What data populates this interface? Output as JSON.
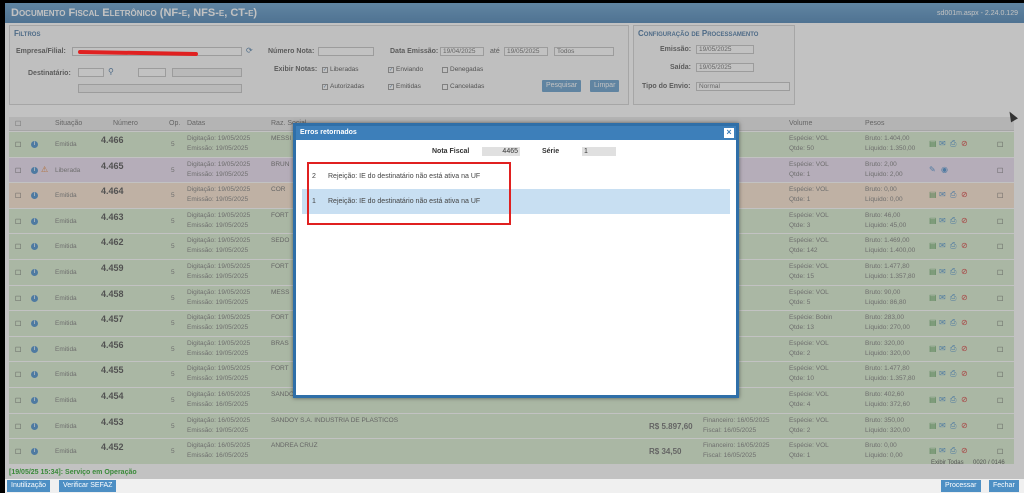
{
  "header": {
    "title": "Documento Fiscal Eletrônico (NF-e, NFS-e, CT-e)",
    "version": "sd001m.aspx - 2.24.0.129"
  },
  "filters": {
    "section": "Filtros",
    "empresa_label": "Empresa/Filial:",
    "destinatario_label": "Destinatário:",
    "numero_label": "Número Nota:",
    "exibir_label": "Exibir Notas:",
    "emissao_label": "Data Emissão:",
    "emissao_de": "19/04/2025",
    "ate_label": "até",
    "emissao_ate": "19/05/2025",
    "periodo": "Todos",
    "checks": [
      "Liberadas",
      "Enviando",
      "Denegadas",
      "Autorizadas",
      "Emitidas",
      "Canceladas"
    ],
    "pesquisar": "Pesquisar",
    "limpar": "Limpar"
  },
  "config": {
    "section": "Configuração de Processamento",
    "emissao_label": "Emissão:",
    "emissao_val": "19/05/2025",
    "saida_label": "Saída:",
    "saida_val": "19/05/2025",
    "tipo_label": "Tipo do Envio:",
    "tipo_val": "Normal"
  },
  "grid": {
    "headers": [
      "Situação",
      "Número",
      "Op.",
      "Datas",
      "Raz. Social",
      "Volume",
      "Pesos"
    ],
    "rows": [
      {
        "sit": "Emitida",
        "num": "4.466",
        "d1": "Digitação: 19/05/2025",
        "d2": "Emissão: 19/05/2025",
        "razao": "MESSI",
        "vol1": "Espécie: VOL",
        "vol2": "Qtde: 50",
        "p1": "Bruto: 1.404,00",
        "p2": "Líquido: 1.350,00",
        "color": "green"
      },
      {
        "sit": "Liberada",
        "num": "4.465",
        "d1": "Digitação: 19/05/2025",
        "d2": "Emissão: 19/05/2025",
        "razao": "BRUN",
        "vol1": "Espécie: VOL",
        "vol2": "Qtde: 1",
        "p1": "Bruto: 2,00",
        "p2": "Líquido: 2,00",
        "color": "purple"
      },
      {
        "sit": "Emitida",
        "num": "4.464",
        "d1": "Digitação: 19/05/2025",
        "d2": "Emissão: 19/05/2025",
        "razao": "COR",
        "vol1": "Espécie: VOL",
        "vol2": "Qtde: 1",
        "p1": "Bruto: 0,00",
        "p2": "Líquido: 0,00",
        "color": "orange"
      },
      {
        "sit": "Emitida",
        "num": "4.463",
        "d1": "Digitação: 19/05/2025",
        "d2": "Emissão: 19/05/2025",
        "razao": "FORT",
        "vol1": "Espécie: VOL",
        "vol2": "Qtde: 3",
        "p1": "Bruto: 46,00",
        "p2": "Líquido: 45,00",
        "color": "green"
      },
      {
        "sit": "Emitida",
        "num": "4.462",
        "d1": "Digitação: 19/05/2025",
        "d2": "Emissão: 19/05/2025",
        "razao": "SEDO",
        "vol1": "Espécie: VOL",
        "vol2": "Qtde: 142",
        "p1": "Bruto: 1.469,00",
        "p2": "Líquido: 1.400,00",
        "color": "green"
      },
      {
        "sit": "Emitida",
        "num": "4.459",
        "d1": "Digitação: 19/05/2025",
        "d2": "Emissão: 19/05/2025",
        "razao": "FORT",
        "vol1": "Espécie: VOL",
        "vol2": "Qtde: 15",
        "p1": "Bruto: 1.477,80",
        "p2": "Líquido: 1.357,80",
        "color": "green"
      },
      {
        "sit": "Emitida",
        "num": "4.458",
        "d1": "Digitação: 19/05/2025",
        "d2": "Emissão: 19/05/2025",
        "razao": "MESS",
        "vol1": "Espécie: VOL",
        "vol2": "Qtde: 5",
        "p1": "Bruto: 90,00",
        "p2": "Líquido: 86,80",
        "color": "green"
      },
      {
        "sit": "Emitida",
        "num": "4.457",
        "d1": "Digitação: 19/05/2025",
        "d2": "Emissão: 19/05/2025",
        "razao": "FORT",
        "vol1": "Espécie: Bobin",
        "vol2": "Qtde: 13",
        "p1": "Bruto: 283,00",
        "p2": "Líquido: 270,00",
        "color": "green"
      },
      {
        "sit": "Emitida",
        "num": "4.456",
        "d1": "Digitação: 19/05/2025",
        "d2": "Emissão: 19/05/2025",
        "razao": "BRAS",
        "vol1": "Espécie: VOL",
        "vol2": "Qtde: 2",
        "p1": "Bruto: 320,00",
        "p2": "Líquido: 320,00",
        "color": "green"
      },
      {
        "sit": "Emitida",
        "num": "4.455",
        "d1": "Digitação: 19/05/2025",
        "d2": "Emissão: 19/05/2025",
        "razao": "FORT",
        "vol1": "Espécie: VOL",
        "vol2": "Qtde: 10",
        "p1": "Bruto: 1.477,80",
        "p2": "Líquido: 1.357,80",
        "color": "green"
      },
      {
        "sit": "Emitida",
        "num": "4.454",
        "d1": "Digitação: 16/05/2025",
        "d2": "Emissão: 16/05/2025",
        "razao": "SANDO",
        "vol1": "Espécie: VOL",
        "vol2": "Qtde: 4",
        "p1": "Bruto: 402,60",
        "p2": "Líquido: 372,60",
        "color": "green"
      },
      {
        "sit": "Emitida",
        "num": "4.453",
        "d1": "Digitação: 16/05/2025",
        "d2": "Emissão: 19/05/2025",
        "razao": "SANDOY S.A. INDUSTRIA DE PLASTICOS",
        "vol1": "Espécie: VOL",
        "vol2": "Qtde: 2",
        "p1": "Bruto: 350,00",
        "p2": "Líquido: 320,00",
        "color": "green",
        "valor": "R$ 5.897,60",
        "fin1": "Financeiro: 16/05/2025",
        "fin2": "Fiscal: 16/05/2025"
      },
      {
        "sit": "Emitida",
        "num": "4.452",
        "d1": "Digitação: 16/05/2025",
        "d2": "Emissão: 16/05/2025",
        "razao": "ANDREA CRUZ",
        "vol1": "Espécie: VOL",
        "vol2": "Qtde: 1",
        "p1": "Bruto: 0,00",
        "p2": "Líquido: 0,00",
        "color": "green",
        "valor": "R$ 34,50",
        "fin1": "Financeiro: 16/05/2025",
        "fin2": "Fiscal: 16/05/2025"
      }
    ]
  },
  "status": {
    "text": "[19/05/25 15:34]: Serviço em Operação",
    "exibir_todas": "Exibir Todas",
    "count": "0020 / 0146"
  },
  "bottom": {
    "inutilizacao": "Inutilização",
    "verificar": "Verificar SEFAZ",
    "processar": "Processar",
    "fechar": "Fechar"
  },
  "modal": {
    "title": "Erros retornados",
    "close": "×",
    "nota_label": "Nota Fiscal",
    "nota_val": "4465",
    "serie_label": "Série",
    "serie_val": "1",
    "errors": [
      {
        "n": "2",
        "msg": "Rejeição: IE do destinatário não está ativa na UF"
      },
      {
        "n": "1",
        "msg": "Rejeição: IE do destinatário não está ativa na UF"
      }
    ]
  }
}
